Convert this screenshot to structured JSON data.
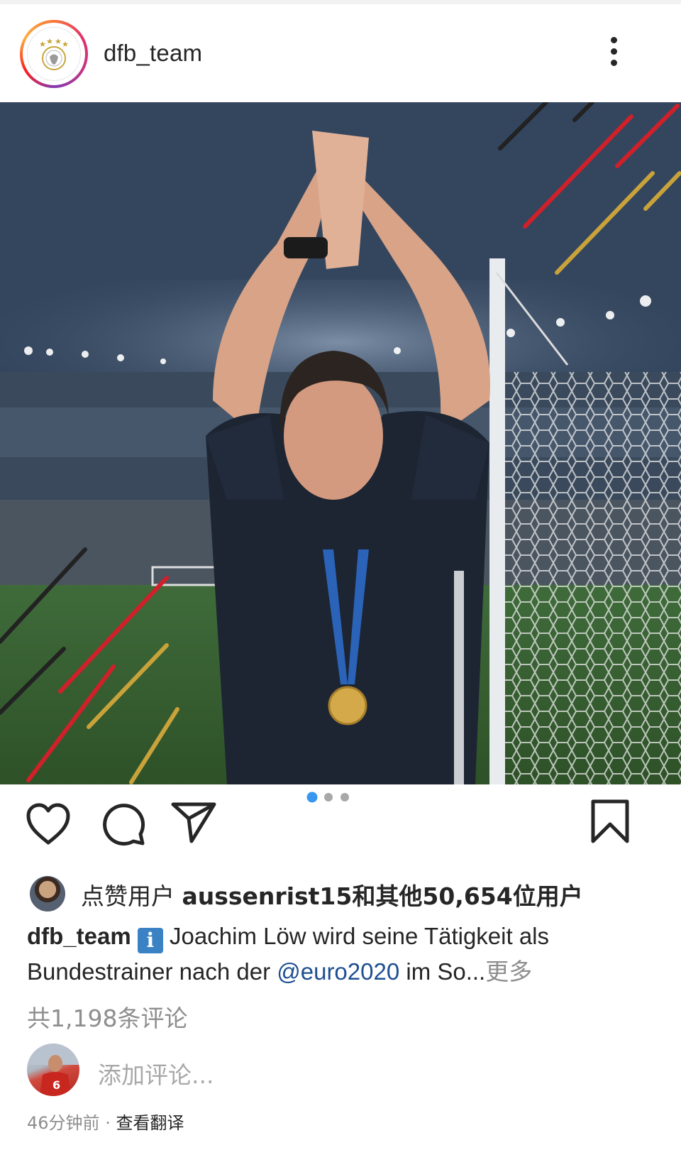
{
  "post": {
    "username": "dfb_team",
    "more_icon": "more-vertical-icon"
  },
  "photo": {
    "description_icon": "photo"
  },
  "actions": {
    "like_icon": "heart-icon",
    "comment_icon": "comment-icon",
    "share_icon": "send-icon",
    "save_icon": "bookmark-icon",
    "carousel": {
      "count": 3,
      "active": 1
    }
  },
  "likes": {
    "prefix": "点赞用户 ",
    "user": "aussenrist15",
    "suffix": "和其他50,654位用户"
  },
  "caption": {
    "username": "dfb_team",
    "badge": "i",
    "text_part1": "Joachim Löw wird seine Tätigkeit als Bundestrainer nach der ",
    "mention": "@euro2020",
    "text_part2": " im So...",
    "more": "更多"
  },
  "comments": {
    "count_text": "共1,198条评论",
    "add_placeholder": "添加评论..."
  },
  "footer": {
    "time": "46分钟前",
    "separator": "·",
    "translate": "查看翻译"
  },
  "colors": {
    "accent_blue": "#3897f0",
    "mention": "#1e4f91",
    "muted": "#8e8e8e",
    "text": "#262626"
  }
}
